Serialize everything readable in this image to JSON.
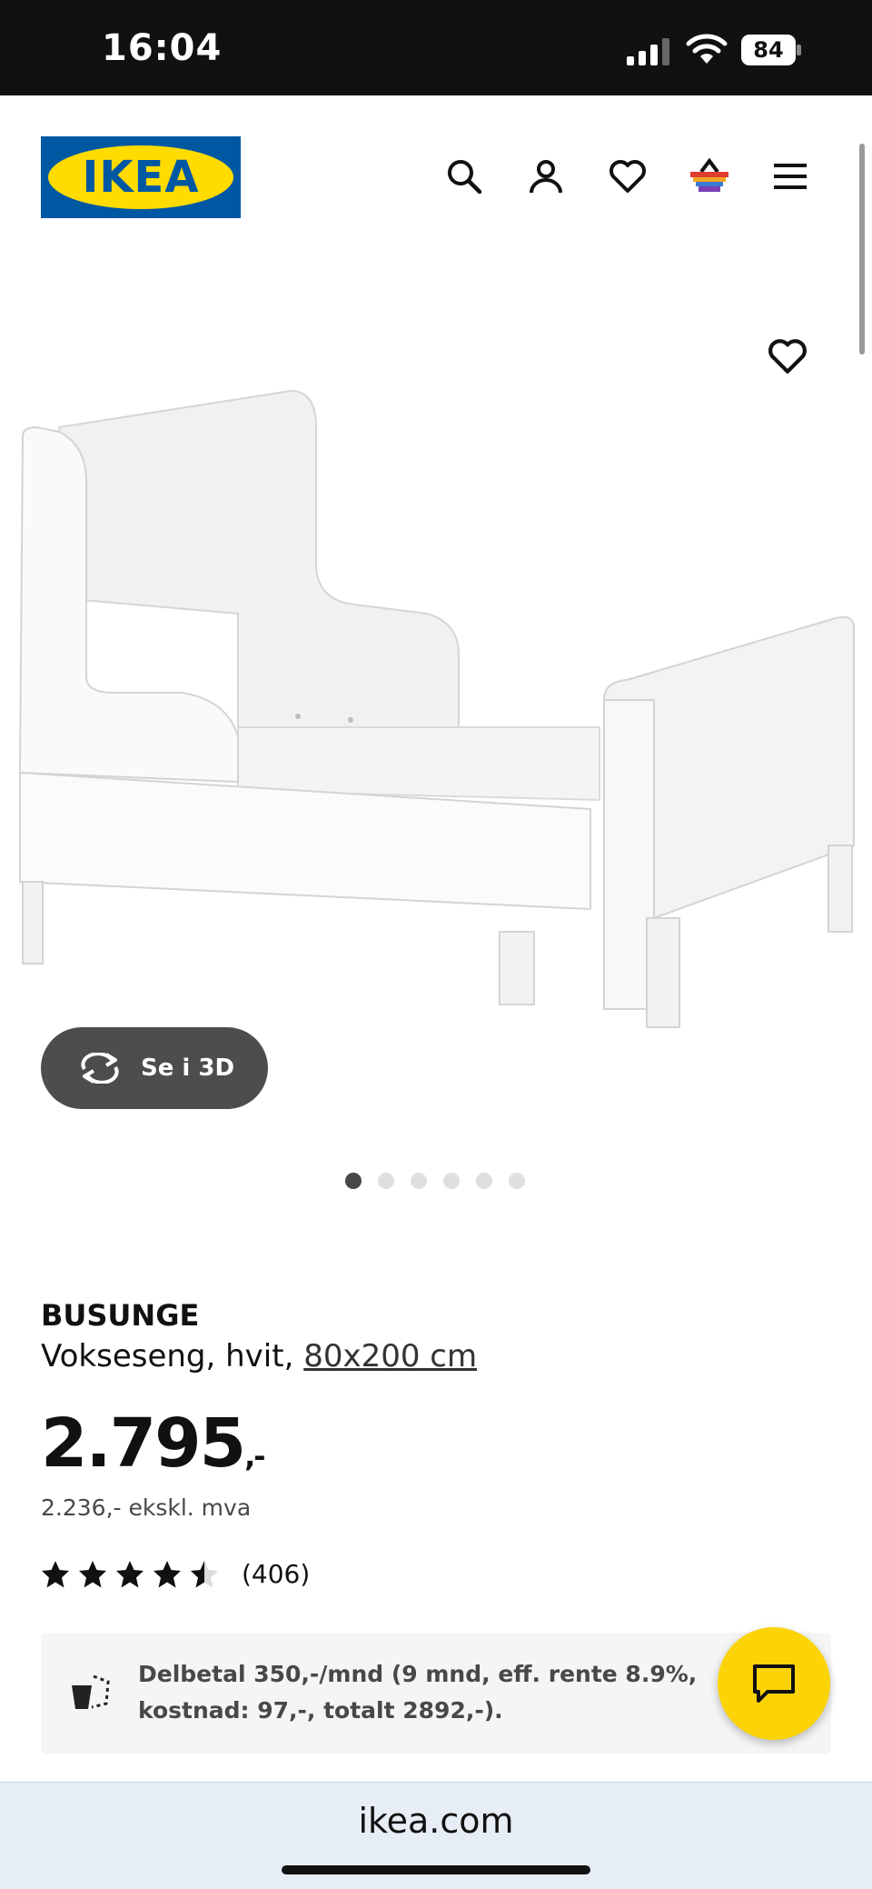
{
  "status_bar": {
    "time": "16:04",
    "battery": "84"
  },
  "header": {
    "logo_text": "IKEA",
    "icons": [
      "search-icon",
      "account-icon",
      "favorites-icon",
      "cart-icon",
      "menu-icon"
    ]
  },
  "gallery": {
    "view_3d_label": "Se i 3D",
    "image_count": 6,
    "active_index": 0
  },
  "product": {
    "name": "BUSUNGE",
    "description": "Vokseseng, hvit,",
    "size_link": "80x200 cm",
    "price": "2.795",
    "price_suffix": ",-",
    "price_ex_vat": "2.236,- ekskl. mva",
    "rating_stars": 4.5,
    "rating_count": "(406)"
  },
  "financing": {
    "text": "Delbetal 350,-/mnd (9 mnd, eff. rente 8.9%, kostnad: 97,-, totalt 2892,-)."
  },
  "browser": {
    "url": "ikea.com"
  },
  "colors": {
    "brand_blue": "#0058a3",
    "brand_yellow": "#ffdb00",
    "chat_yellow": "#fcd307"
  }
}
